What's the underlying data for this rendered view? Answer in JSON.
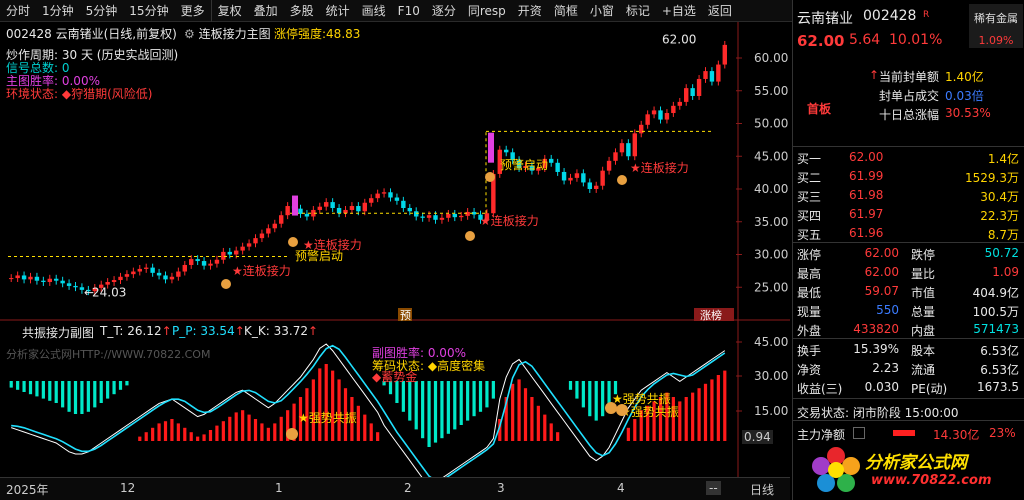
{
  "toolbar": {
    "items": [
      "分时",
      "1分钟",
      "5分钟",
      "15分钟",
      "更多",
      "复权",
      "叠加",
      "多股",
      "统计",
      "画线",
      "F10",
      "逐分",
      "同resp",
      "开资",
      "简框",
      "小窗",
      "标记",
      "+自选",
      "返回"
    ]
  },
  "main_chart": {
    "title": "002428 云南锗业(日线,前复权)",
    "indicator_name": "连板接力主图",
    "strength_label": "涨停强度:",
    "strength_value": "48.83",
    "info_lines": [
      {
        "text": "炒作周期: 30 天 (历史实战回测)",
        "color": "#e8e8e8"
      },
      {
        "text": "信号总数: 0",
        "color": "#00d0d0"
      },
      {
        "text": "主图胜率: 0.00%",
        "color": "#e040e0"
      },
      {
        "text": "环境状态: ◆狩猎期(风险低)",
        "color": "#ff3a3a"
      }
    ],
    "price_ticks": [
      "60.00",
      "55.00",
      "50.00",
      "45.00",
      "40.00",
      "35.00",
      "30.00",
      "25.00"
    ],
    "high_label": "62.00",
    "low_label": "24.03",
    "annotations": [
      "★连板接力",
      "预警启动",
      "★连板接力",
      "★连板接力",
      "预警启动",
      "★连板接力"
    ],
    "tags": [
      "预",
      "涨榜"
    ]
  },
  "sub_chart": {
    "title": "共振接力副图",
    "tt_label": "T_T:",
    "tt_value": "26.12",
    "pp_label": "P_P:",
    "pp_value": "33.54",
    "kk_label": "K_K:",
    "kk_value": "33.72",
    "info_lines": [
      "副图胜率: 0.00%",
      "筹码状态: ◆高度密集",
      "◆蓄势金"
    ],
    "y_ticks": [
      "45.00",
      "30.00",
      "15.00"
    ],
    "annotations": [
      "★强势共振",
      "★强势共振",
      "★强势共振"
    ],
    "scale": "0.94",
    "watermark": "分析家公式网HTTP://WWW.70822.COM"
  },
  "bottom_bar": {
    "dates": [
      "2025年",
      "12",
      "1",
      "2",
      "3",
      "4"
    ],
    "more": "--",
    "period": "日线"
  },
  "quote": {
    "name": "云南锗业",
    "code": "002428",
    "badge": "R",
    "tag": "稀有金属",
    "tag_pct": "1.09%",
    "price": "62.00",
    "change": "5.64",
    "pct": "10.01%",
    "seal_label": "当前封单额",
    "seal_value": "1.40亿",
    "seal_ratio_label": "封单占成交",
    "seal_ratio_value": "0.03倍",
    "ten_day_label": "十日总涨幅",
    "ten_day_value": "30.53%",
    "board": "首板",
    "bids": [
      {
        "label": "买一",
        "price": "62.00",
        "vol": "1.4亿"
      },
      {
        "label": "买二",
        "price": "61.99",
        "vol": "1529.3万"
      },
      {
        "label": "买三",
        "price": "61.98",
        "vol": "30.4万"
      },
      {
        "label": "买四",
        "price": "61.97",
        "vol": "22.3万"
      },
      {
        "label": "买五",
        "price": "61.96",
        "vol": "8.7万"
      }
    ],
    "stats": [
      {
        "l1": "涨停",
        "v1": "62.00",
        "c1": "red",
        "l2": "跌停",
        "v2": "50.72",
        "c2": "grn"
      },
      {
        "l1": "最高",
        "v1": "62.00",
        "c1": "red",
        "l2": "量比",
        "v2": "1.09",
        "c2": "red"
      },
      {
        "l1": "最低",
        "v1": "59.07",
        "c1": "red",
        "l2": "市值",
        "v2": "404.9亿",
        "c2": "wht"
      },
      {
        "l1": "现量",
        "v1": "550",
        "c1": "blu",
        "l2": "总量",
        "v2": "100.5万",
        "c2": "wht"
      },
      {
        "l1": "外盘",
        "v1": "433820",
        "c1": "red",
        "l2": "内盘",
        "v2": "571473",
        "c2": "grn"
      }
    ],
    "stats2": [
      {
        "l1": "换手",
        "v1": "15.39%",
        "l2": "股本",
        "v2": "6.53亿"
      },
      {
        "l1": "净资",
        "v1": "2.23",
        "l2": "流通",
        "v2": "6.53亿"
      },
      {
        "l1": "收益(三)",
        "v1": "0.030",
        "l2": "PE(动)",
        "v2": "1673.5"
      }
    ],
    "trade_state": "交易状态: 闭市阶段 15:00:00",
    "main_flow_label": "主力净额",
    "main_flow_value": "14.30亿",
    "main_flow_pct": "23%",
    "logo_text": "分析家公式网",
    "logo_url": "www.70822.com"
  }
}
